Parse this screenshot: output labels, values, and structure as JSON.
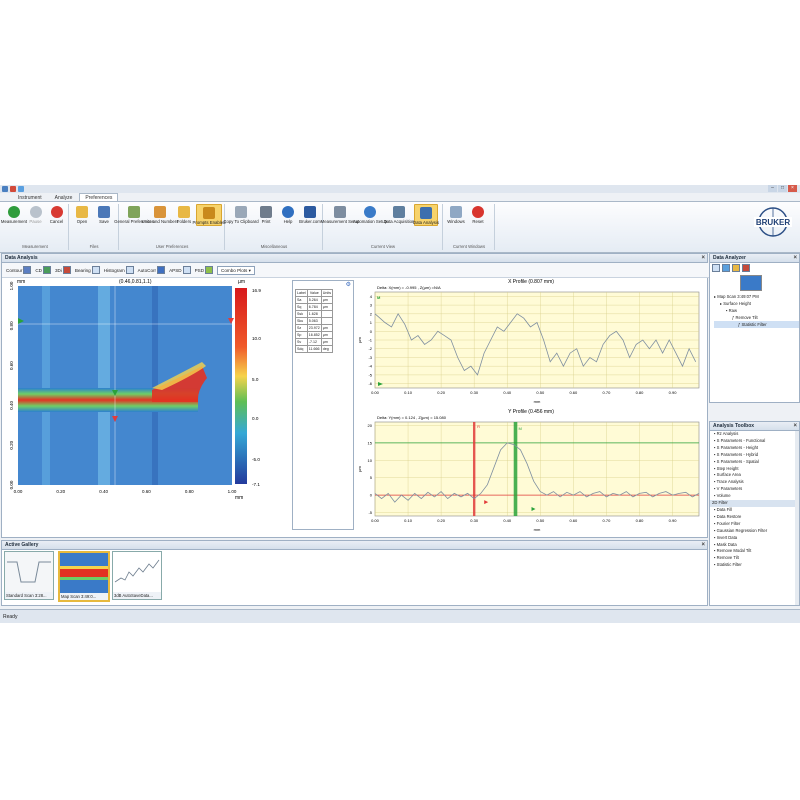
{
  "tabs": [
    "Instrument",
    "Analyze",
    "Preferences"
  ],
  "active_tab": "Preferences",
  "ribbon": {
    "groups": [
      {
        "label": "Measurement",
        "buttons": [
          "Measurement",
          "Pause",
          "Cancel"
        ]
      },
      {
        "label": "Files",
        "buttons": [
          "Open",
          "Save"
        ]
      },
      {
        "label": "User Preferences",
        "buttons": [
          "General Preferences",
          "Units and Numbers",
          "Folders",
          "Prompts Enabled"
        ]
      },
      {
        "label": "Miscellaneous",
        "buttons": [
          "Copy To Clipboard",
          "Print",
          "Help",
          "Bruker.com"
        ]
      },
      {
        "label": "Current View",
        "buttons": [
          "Measurement Setup",
          "Automation Setup",
          "Data Acquisition",
          "Data Analysis"
        ]
      },
      {
        "label": "Current Windows",
        "buttons": [
          "Windows",
          "Reset"
        ]
      }
    ],
    "highlighted": [
      "Prompts Enabled",
      "Data Analysis"
    ],
    "logo_text": "BRUKER"
  },
  "data_analysis": {
    "title": "Data Analysis",
    "toolbar": [
      "Contour",
      "CD",
      "3Di",
      "Bearing",
      "Histogram",
      "AutoCorr",
      "APSD",
      "PSD"
    ],
    "combo": "Combo Plots",
    "map": {
      "unit_top": "mm",
      "unit_right": "µm",
      "coord_readout": "(0.46,0.81,1.1)",
      "y_ticks": [
        "1.00",
        "0.80",
        "0.60",
        "0.40",
        "0.20",
        "0.00"
      ],
      "x_ticks": [
        "0.00",
        "0.20",
        "0.40",
        "0.60",
        "0.80",
        "1.00"
      ],
      "x_unit": "mm",
      "colorbar_ticks": [
        "16.9",
        "10.0",
        "5.0",
        "0.0",
        "-5.0",
        "-7.1"
      ]
    },
    "params_table": {
      "headers": [
        "Label",
        "Value",
        "Units"
      ],
      "rows": [
        [
          "Sa",
          "5.264",
          "µm"
        ],
        [
          "Sq",
          "6.784",
          "µm"
        ],
        [
          "Ssk",
          "1.628",
          ""
        ],
        [
          "Sku",
          "5.063",
          ""
        ],
        [
          "Sz",
          "23.972",
          "µm"
        ],
        [
          "Sp",
          "16.852",
          "µm"
        ],
        [
          "Sv",
          "-7.12",
          "µm"
        ],
        [
          "Sdq",
          "11.666",
          "deg"
        ]
      ]
    },
    "x_profile": {
      "title": "X Profile (0.807 mm)",
      "delta": "Delta:  X(mm) = -0.995 , Z(µm) =N/A",
      "y_ticks": [
        "4",
        "3",
        "2",
        "1",
        "0",
        "-1",
        "-2",
        "-3",
        "-4",
        "-5",
        "-6"
      ],
      "x_ticks": [
        "0.00",
        "0.10",
        "0.20",
        "0.30",
        "0.40",
        "0.50",
        "0.60",
        "0.70",
        "0.80",
        "0.90"
      ],
      "y_unit": "µm",
      "x_unit": "mm",
      "marker_m": "M",
      "x": [
        0,
        0.03,
        0.05,
        0.07,
        0.09,
        0.11,
        0.13,
        0.15,
        0.17,
        0.19,
        0.21,
        0.23,
        0.25,
        0.27,
        0.29,
        0.31,
        0.33,
        0.35,
        0.37,
        0.39,
        0.41,
        0.43,
        0.45,
        0.47,
        0.49,
        0.51,
        0.53,
        0.55,
        0.57,
        0.59,
        0.61,
        0.63,
        0.65,
        0.67,
        0.69,
        0.71,
        0.73,
        0.75,
        0.77,
        0.79,
        0.81,
        0.83,
        0.85,
        0.87,
        0.89,
        0.91,
        0.93,
        0.95,
        0.97
      ],
      "y": [
        2,
        1,
        0.5,
        2,
        0.8,
        -1,
        -0.5,
        -1.5,
        -1,
        0,
        -0.5,
        -1,
        -3,
        -4.5,
        -4,
        -5,
        -2.5,
        -1,
        0.5,
        0,
        1,
        2,
        1.5,
        0.5,
        1,
        -1,
        -3.5,
        -2.5,
        -4,
        -2.5,
        -2,
        -4,
        -3,
        -3.5,
        -1.5,
        -0.5,
        0,
        -1,
        -3,
        -1.5,
        -1,
        -2,
        -1,
        -2.5,
        -1,
        -2.5,
        -4,
        -2,
        -3.5
      ]
    },
    "y_profile": {
      "title": "Y Profile (0.456 mm)",
      "delta": "Delta:  Y(mm) = 0.124 , Z(µm) = 15.080",
      "y_ticks": [
        "20",
        "15",
        "10",
        "5",
        "0",
        "-5"
      ],
      "x_ticks": [
        "0.00",
        "0.10",
        "0.20",
        "0.30",
        "0.40",
        "0.50",
        "0.60",
        "0.70",
        "0.80",
        "0.90"
      ],
      "y_unit": "µm",
      "x_unit": "mm",
      "marker_r": "R",
      "marker_m": "M",
      "x": [
        0,
        0.02,
        0.04,
        0.06,
        0.08,
        0.1,
        0.12,
        0.14,
        0.16,
        0.18,
        0.2,
        0.22,
        0.24,
        0.26,
        0.28,
        0.3,
        0.32,
        0.34,
        0.36,
        0.38,
        0.4,
        0.42,
        0.44,
        0.46,
        0.48,
        0.5,
        0.52,
        0.54,
        0.56,
        0.58,
        0.6,
        0.62,
        0.64,
        0.66,
        0.68,
        0.7,
        0.72,
        0.74,
        0.76,
        0.78,
        0.8,
        0.82,
        0.84,
        0.86,
        0.88,
        0.9,
        0.92,
        0.94,
        0.96,
        0.98
      ],
      "y": [
        0.5,
        -1,
        0.5,
        -2,
        0,
        -1.5,
        0.5,
        -1,
        0.8,
        -0.5,
        1,
        -1,
        0.5,
        -0.5,
        0.5,
        -1,
        0.5,
        3,
        8,
        13,
        15,
        14.5,
        13,
        9,
        4,
        1,
        0,
        1,
        -0.5,
        0.8,
        0,
        1,
        -0.5,
        0.5,
        1,
        -0.5,
        0.5,
        0,
        1,
        -0.5,
        0.5,
        0.8,
        -0.5,
        0.5,
        1,
        0,
        0.5,
        0.8,
        -0.5,
        0.5
      ]
    }
  },
  "data_analyzer": {
    "title": "Data Analyzer",
    "tree": [
      "Map Scan 3:49:07 PM",
      "Surface Height",
      "Raw",
      "Remove Tilt",
      "Statistic Filter"
    ]
  },
  "analysis_toolbox": {
    "title": "Analysis Toolbox",
    "items": [
      {
        "label": "Rz Analysis",
        "group": false
      },
      {
        "label": "S Parameters - Functional",
        "group": false
      },
      {
        "label": "S Parameters - Height",
        "group": false
      },
      {
        "label": "S Parameters - Hybrid",
        "group": false
      },
      {
        "label": "S Parameters - Spatial",
        "group": false
      },
      {
        "label": "Step Height",
        "group": false
      },
      {
        "label": "Surface Area",
        "group": false
      },
      {
        "label": "Trace Analysis",
        "group": false
      },
      {
        "label": "V Parameters",
        "group": false
      },
      {
        "label": "Volume",
        "group": false
      },
      {
        "label": "2D Filter",
        "group": true
      },
      {
        "label": "Data Fill",
        "group": false
      },
      {
        "label": "Data Restore",
        "group": false
      },
      {
        "label": "Fourier Filter",
        "group": false
      },
      {
        "label": "Gaussian Regression Filter",
        "group": false
      },
      {
        "label": "Invert Data",
        "group": false
      },
      {
        "label": "Mask Data",
        "group": false
      },
      {
        "label": "Remove Modal Tilt",
        "group": false
      },
      {
        "label": "Remove Tilt",
        "group": false
      },
      {
        "label": "Statistic Filter",
        "group": false
      }
    ]
  },
  "gallery": {
    "title": "Active Gallery",
    "thumbs": [
      "Standard Scan 3:28...",
      "Map Scan 3:49:0...",
      "3dB AutoSaveData..."
    ]
  },
  "status": "Ready",
  "colors": {
    "accent": "#f7d36b",
    "plot_bg": "#fffbd6",
    "profile_line": "#7f8fa0",
    "marker_red": "#e23b3b",
    "marker_green": "#2aa23a"
  }
}
